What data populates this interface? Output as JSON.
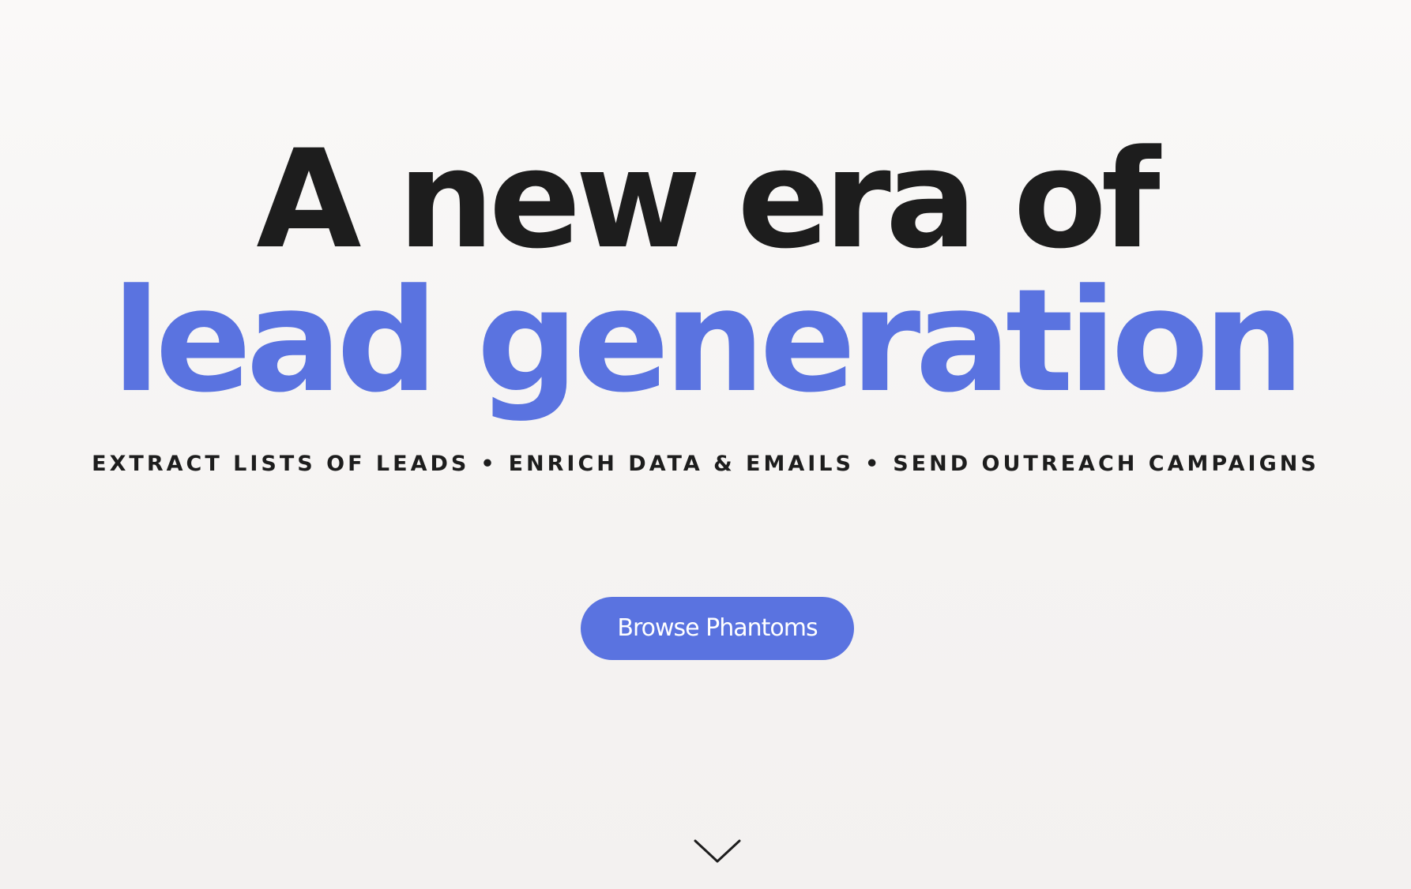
{
  "hero": {
    "headline_line1": "A new era of",
    "headline_line2": "lead generation",
    "taglines": [
      "EXTRACT LISTS OF LEADS",
      "ENRICH DATA & EMAILS",
      "SEND OUTREACH CAMPAIGNS"
    ],
    "separator": "•",
    "cta_label": "Browse Phantoms",
    "scroll_icon": "chevron-down-icon"
  },
  "colors": {
    "accent": "#5a73e0",
    "text": "#1d1d1d",
    "background": "#f7f6f5"
  }
}
